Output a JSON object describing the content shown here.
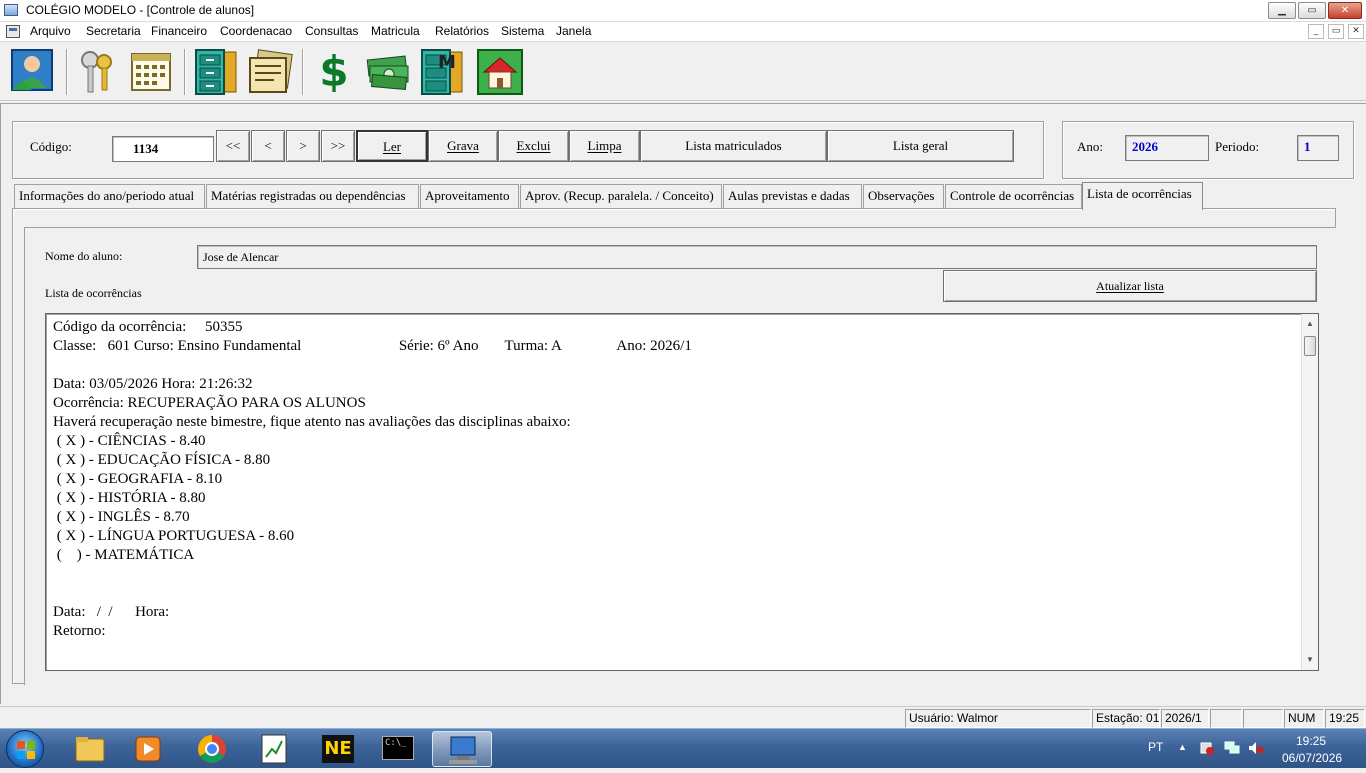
{
  "window": {
    "title": "COLÉGIO MODELO - [Controle de alunos]",
    "min_symbol": "▁",
    "max_symbol": "▭",
    "close_symbol": "✕",
    "mdi_min_symbol": "_",
    "mdi_max_symbol": "▭",
    "mdi_close_symbol": "✕"
  },
  "menu": [
    "Arquivo",
    "Secretaria",
    "Financeiro",
    "Coordenacao",
    "Consultas",
    "Matricula",
    "Relatórios",
    "Sistema",
    "Janela"
  ],
  "toolbar_icons": [
    "user-card-icon",
    "keys-icon",
    "calendar-icon",
    "file-cabinet-icon",
    "documents-icon",
    "dollar-icon",
    "money-bills-icon",
    "file-cabinet-m-icon",
    "home-icon"
  ],
  "dollar_symbol": "$",
  "cabinet_letter": "M",
  "top": {
    "codigo_label": "Código:",
    "codigo_value": "1134",
    "nav_first": "<<",
    "nav_prev": "<",
    "nav_next": ">",
    "nav_last": ">>",
    "btn_ler": "Ler",
    "btn_grava": "Grava",
    "btn_exclui": "Exclui",
    "btn_limpa": "Limpa",
    "btn_lista_matriculados": "Lista matriculados",
    "btn_lista_geral": "Lista geral",
    "ano_label": "Ano:",
    "ano_value": "2026",
    "periodo_label": "Periodo:",
    "periodo_value": "1",
    "value_color": "#0000cc"
  },
  "tabs": [
    "Informações do ano/periodo atual",
    "Matérias registradas ou dependências",
    "Aproveitamento",
    "Aprov. (Recup. paralela. / Conceito)",
    "Aulas previstas e dadas",
    "Observações",
    "Controle de ocorrências",
    "Lista de ocorrências"
  ],
  "active_tab": "Lista de ocorrências",
  "page": {
    "nome_label": "Nome do aluno:",
    "nome_value": "Jose de Alencar",
    "lista_label": "Lista de ocorrências",
    "btn_atualizar": "Atualizar lista"
  },
  "memo_lines": [
    "Código da ocorrência:     50355",
    "Classe:   601 Curso: Ensino Fundamental                          Série: 6º Ano       Turma: A               Ano: 2026/1",
    "",
    "Data: 03/05/2026 Hora: 21:26:32",
    "Ocorrência: RECUPERAÇÃO PARA OS ALUNOS",
    "Haverá recuperação neste bimestre, fique atento nas avaliações das disciplinas abaixo:",
    " ( X ) - CIÊNCIAS - 8.40",
    " ( X ) - EDUCAÇÃO FÍSICA - 8.80",
    " ( X ) - GEOGRAFIA - 8.10",
    " ( X ) - HISTÓRIA - 8.80",
    " ( X ) - INGLÊS - 8.70",
    " ( X ) - LÍNGUA PORTUGUESA - 8.60",
    " (    ) - MATEMÁTICA",
    "",
    "",
    "Data:   /  /      Hora:",
    "Retorno:"
  ],
  "scroll_up": "▲",
  "scroll_down": "▼",
  "status": {
    "usuario": "Usuário: Walmor",
    "estacao": "Estação: 01",
    "ano_periodo": "2026/1",
    "blank1": "",
    "blank2": "",
    "num": "NUM",
    "time": "19:25"
  },
  "taskbar": {
    "apps": [
      "folder-icon",
      "media-player-icon",
      "chrome-icon",
      "notepad-chart-icon",
      "ne-icon",
      "terminal-icon",
      "network-computer-icon"
    ],
    "ne_text": "NE",
    "terminal_text": "C:\\_",
    "lang": "PT",
    "clock_time": "19:25",
    "clock_date": "06/07/2026",
    "tray_up": "▲"
  }
}
